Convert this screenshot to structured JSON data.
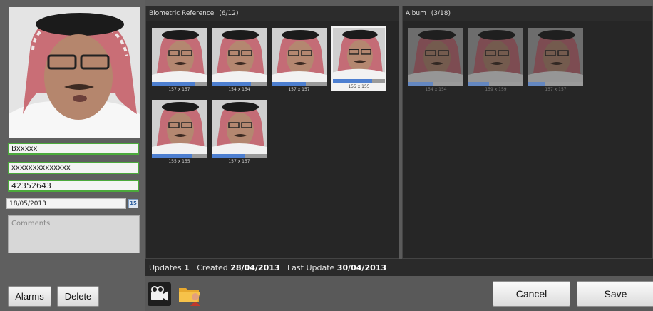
{
  "person": {
    "name": "Bxxxxx",
    "id_number": "xxxxxxxxxxxxxx",
    "phone": "42352643",
    "date": "18/05/2013",
    "comments_placeholder": "Comments"
  },
  "left_buttons": {
    "alarms": "Alarms",
    "delete": "Delete"
  },
  "biometric": {
    "title": "Biometric Reference",
    "count": "(6/12)",
    "thumbs": [
      {
        "dims": "157 x 157",
        "quality": 0.78
      },
      {
        "dims": "154 x 154",
        "quality": 0.72
      },
      {
        "dims": "157 x 157",
        "quality": 0.62
      },
      {
        "dims": "155 x 155",
        "quality": 0.75
      },
      {
        "dims": "155 x 155",
        "quality": 0.74
      },
      {
        "dims": "157 x 157",
        "quality": 0.6
      }
    ]
  },
  "album": {
    "title": "Album",
    "count": "(3/18)",
    "thumbs": [
      {
        "dims": "154 x 154",
        "quality": 0.45
      },
      {
        "dims": "159 x 159",
        "quality": 0.38
      },
      {
        "dims": "157 x 157",
        "quality": 0.3
      }
    ]
  },
  "status": {
    "updates_label": "Updates",
    "updates_value": "1",
    "created_label": "Created",
    "created_value": "28/04/2013",
    "last_update_label": "Last Update",
    "last_update_value": "30/04/2013"
  },
  "actions": {
    "cancel": "Cancel",
    "save": "Save"
  },
  "icons": {
    "calendar": "calendar-icon",
    "camera": "video-camera-icon",
    "folder": "folder-person-icon"
  },
  "colors": {
    "field_border": "#4caa3c",
    "quality_bar": "#4d7fd0"
  }
}
